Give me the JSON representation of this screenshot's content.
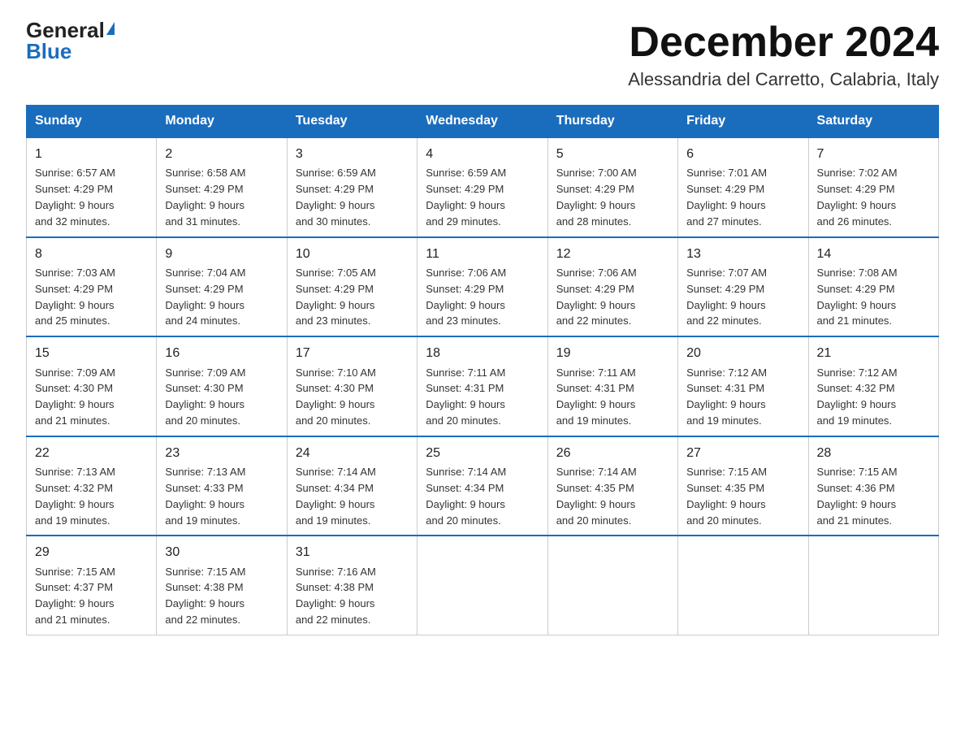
{
  "header": {
    "logo_general": "General",
    "logo_blue": "Blue",
    "month_title": "December 2024",
    "subtitle": "Alessandria del Carretto, Calabria, Italy"
  },
  "days_of_week": [
    "Sunday",
    "Monday",
    "Tuesday",
    "Wednesday",
    "Thursday",
    "Friday",
    "Saturday"
  ],
  "weeks": [
    [
      {
        "day": "1",
        "sunrise": "6:57 AM",
        "sunset": "4:29 PM",
        "daylight": "9 hours and 32 minutes."
      },
      {
        "day": "2",
        "sunrise": "6:58 AM",
        "sunset": "4:29 PM",
        "daylight": "9 hours and 31 minutes."
      },
      {
        "day": "3",
        "sunrise": "6:59 AM",
        "sunset": "4:29 PM",
        "daylight": "9 hours and 30 minutes."
      },
      {
        "day": "4",
        "sunrise": "6:59 AM",
        "sunset": "4:29 PM",
        "daylight": "9 hours and 29 minutes."
      },
      {
        "day": "5",
        "sunrise": "7:00 AM",
        "sunset": "4:29 PM",
        "daylight": "9 hours and 28 minutes."
      },
      {
        "day": "6",
        "sunrise": "7:01 AM",
        "sunset": "4:29 PM",
        "daylight": "9 hours and 27 minutes."
      },
      {
        "day": "7",
        "sunrise": "7:02 AM",
        "sunset": "4:29 PM",
        "daylight": "9 hours and 26 minutes."
      }
    ],
    [
      {
        "day": "8",
        "sunrise": "7:03 AM",
        "sunset": "4:29 PM",
        "daylight": "9 hours and 25 minutes."
      },
      {
        "day": "9",
        "sunrise": "7:04 AM",
        "sunset": "4:29 PM",
        "daylight": "9 hours and 24 minutes."
      },
      {
        "day": "10",
        "sunrise": "7:05 AM",
        "sunset": "4:29 PM",
        "daylight": "9 hours and 23 minutes."
      },
      {
        "day": "11",
        "sunrise": "7:06 AM",
        "sunset": "4:29 PM",
        "daylight": "9 hours and 23 minutes."
      },
      {
        "day": "12",
        "sunrise": "7:06 AM",
        "sunset": "4:29 PM",
        "daylight": "9 hours and 22 minutes."
      },
      {
        "day": "13",
        "sunrise": "7:07 AM",
        "sunset": "4:29 PM",
        "daylight": "9 hours and 22 minutes."
      },
      {
        "day": "14",
        "sunrise": "7:08 AM",
        "sunset": "4:29 PM",
        "daylight": "9 hours and 21 minutes."
      }
    ],
    [
      {
        "day": "15",
        "sunrise": "7:09 AM",
        "sunset": "4:30 PM",
        "daylight": "9 hours and 21 minutes."
      },
      {
        "day": "16",
        "sunrise": "7:09 AM",
        "sunset": "4:30 PM",
        "daylight": "9 hours and 20 minutes."
      },
      {
        "day": "17",
        "sunrise": "7:10 AM",
        "sunset": "4:30 PM",
        "daylight": "9 hours and 20 minutes."
      },
      {
        "day": "18",
        "sunrise": "7:11 AM",
        "sunset": "4:31 PM",
        "daylight": "9 hours and 20 minutes."
      },
      {
        "day": "19",
        "sunrise": "7:11 AM",
        "sunset": "4:31 PM",
        "daylight": "9 hours and 19 minutes."
      },
      {
        "day": "20",
        "sunrise": "7:12 AM",
        "sunset": "4:31 PM",
        "daylight": "9 hours and 19 minutes."
      },
      {
        "day": "21",
        "sunrise": "7:12 AM",
        "sunset": "4:32 PM",
        "daylight": "9 hours and 19 minutes."
      }
    ],
    [
      {
        "day": "22",
        "sunrise": "7:13 AM",
        "sunset": "4:32 PM",
        "daylight": "9 hours and 19 minutes."
      },
      {
        "day": "23",
        "sunrise": "7:13 AM",
        "sunset": "4:33 PM",
        "daylight": "9 hours and 19 minutes."
      },
      {
        "day": "24",
        "sunrise": "7:14 AM",
        "sunset": "4:34 PM",
        "daylight": "9 hours and 19 minutes."
      },
      {
        "day": "25",
        "sunrise": "7:14 AM",
        "sunset": "4:34 PM",
        "daylight": "9 hours and 20 minutes."
      },
      {
        "day": "26",
        "sunrise": "7:14 AM",
        "sunset": "4:35 PM",
        "daylight": "9 hours and 20 minutes."
      },
      {
        "day": "27",
        "sunrise": "7:15 AM",
        "sunset": "4:35 PM",
        "daylight": "9 hours and 20 minutes."
      },
      {
        "day": "28",
        "sunrise": "7:15 AM",
        "sunset": "4:36 PM",
        "daylight": "9 hours and 21 minutes."
      }
    ],
    [
      {
        "day": "29",
        "sunrise": "7:15 AM",
        "sunset": "4:37 PM",
        "daylight": "9 hours and 21 minutes."
      },
      {
        "day": "30",
        "sunrise": "7:15 AM",
        "sunset": "4:38 PM",
        "daylight": "9 hours and 22 minutes."
      },
      {
        "day": "31",
        "sunrise": "7:16 AM",
        "sunset": "4:38 PM",
        "daylight": "9 hours and 22 minutes."
      },
      null,
      null,
      null,
      null
    ]
  ],
  "labels": {
    "sunrise": "Sunrise:",
    "sunset": "Sunset:",
    "daylight": "Daylight:"
  }
}
